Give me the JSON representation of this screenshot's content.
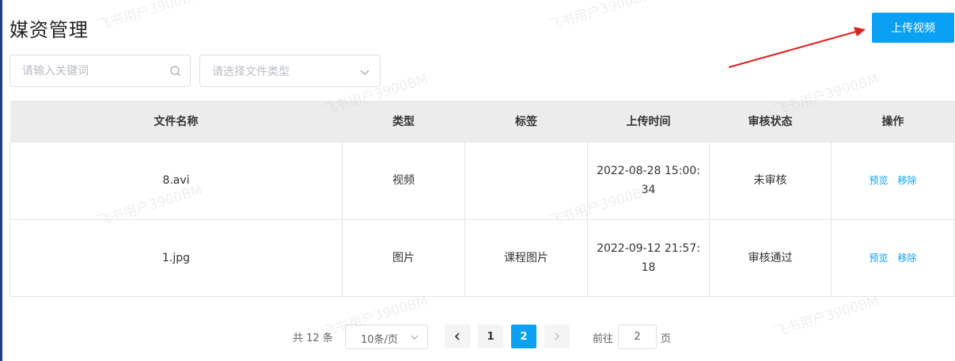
{
  "header": {
    "title": "媒资管理",
    "upload_label": "上传视频"
  },
  "filters": {
    "search_placeholder": "请输入关键词",
    "type_placeholder": "请选择文件类型"
  },
  "table": {
    "headers": [
      "文件名称",
      "类型",
      "标签",
      "上传时间",
      "审核状态",
      "操作"
    ],
    "rows": [
      {
        "name": "8.avi",
        "type": "视频",
        "tag": "",
        "time": "2022-08-28 15:00:34",
        "status": "未审核",
        "preview": "预览",
        "remove": "移除"
      },
      {
        "name": "1.jpg",
        "type": "图片",
        "tag": "课程图片",
        "time": "2022-09-12 21:57:18",
        "status": "审核通过",
        "preview": "预览",
        "remove": "移除"
      }
    ]
  },
  "pagination": {
    "total": "共 12 条",
    "page_size": "10条/页",
    "pages": [
      "1",
      "2"
    ],
    "current_page": "2",
    "goto_label": "前往",
    "goto_value": "2",
    "goto_suffix": "页"
  },
  "watermark": "飞书用户3900BM",
  "colors": {
    "accent": "#0aa0f3",
    "annotation_arrow": "#e02020",
    "header_bg": "#ececec"
  }
}
